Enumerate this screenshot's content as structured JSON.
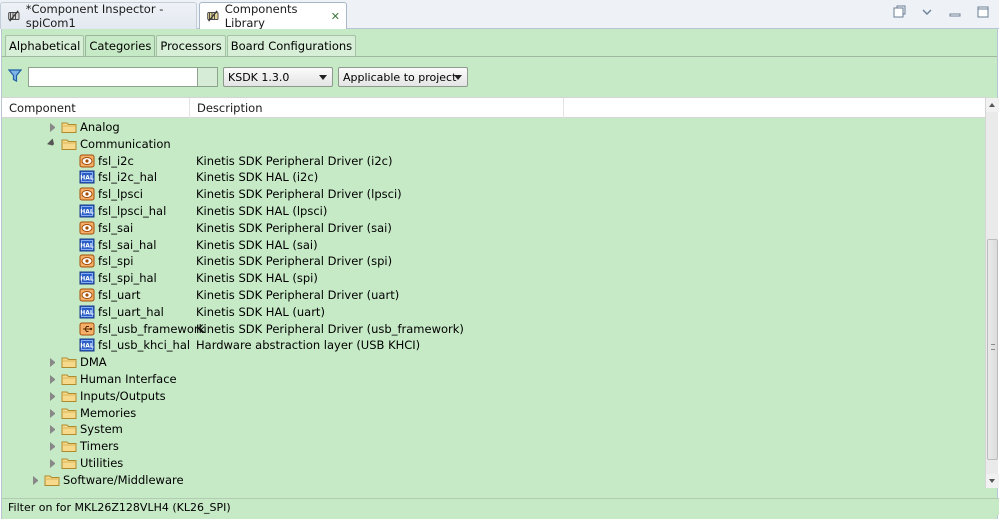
{
  "editor_tabs": [
    {
      "label": "*Component Inspector - spiCom1",
      "active": false
    },
    {
      "label": "Components Library",
      "active": true
    }
  ],
  "view_controls": [
    "restore-icon",
    "view-menu-icon",
    "minimize-icon",
    "maximize-icon"
  ],
  "subtabs": [
    {
      "label": "Alphabetical",
      "active": false
    },
    {
      "label": "Categories",
      "active": true
    },
    {
      "label": "Processors",
      "active": false
    },
    {
      "label": "Board Configurations",
      "active": false
    }
  ],
  "filter": {
    "value": "",
    "placeholder": ""
  },
  "ksdk_select": {
    "value": "KSDK 1.3.0"
  },
  "scope_select": {
    "value": "Applicable to project"
  },
  "columns": {
    "component": "Component",
    "description": "Description"
  },
  "rows": [
    {
      "level": 1,
      "toggle": "collapsed",
      "icon": "folder-icon",
      "name": "Analog",
      "description": ""
    },
    {
      "level": 1,
      "toggle": "expanded",
      "icon": "folder-icon",
      "name": "Communication",
      "description": ""
    },
    {
      "level": 2,
      "toggle": "none",
      "icon": "driver-icon",
      "name": "fsl_i2c",
      "description": "Kinetis SDK Peripheral Driver (i2c)"
    },
    {
      "level": 2,
      "toggle": "none",
      "icon": "hal-icon",
      "name": "fsl_i2c_hal",
      "description": "Kinetis SDK HAL (i2c)"
    },
    {
      "level": 2,
      "toggle": "none",
      "icon": "driver-icon",
      "name": "fsl_lpsci",
      "description": "Kinetis SDK Peripheral Driver (lpsci)"
    },
    {
      "level": 2,
      "toggle": "none",
      "icon": "hal-icon",
      "name": "fsl_lpsci_hal",
      "description": "Kinetis SDK HAL (lpsci)"
    },
    {
      "level": 2,
      "toggle": "none",
      "icon": "driver-icon",
      "name": "fsl_sai",
      "description": "Kinetis SDK Peripheral Driver (sai)"
    },
    {
      "level": 2,
      "toggle": "none",
      "icon": "hal-icon",
      "name": "fsl_sai_hal",
      "description": "Kinetis SDK HAL (sai)"
    },
    {
      "level": 2,
      "toggle": "none",
      "icon": "driver-icon",
      "name": "fsl_spi",
      "description": "Kinetis SDK Peripheral Driver (spi)"
    },
    {
      "level": 2,
      "toggle": "none",
      "icon": "hal-icon",
      "name": "fsl_spi_hal",
      "description": "Kinetis SDK HAL (spi)"
    },
    {
      "level": 2,
      "toggle": "none",
      "icon": "driver-icon",
      "name": "fsl_uart",
      "description": "Kinetis SDK Peripheral Driver (uart)"
    },
    {
      "level": 2,
      "toggle": "none",
      "icon": "hal-icon",
      "name": "fsl_uart_hal",
      "description": "Kinetis SDK HAL (uart)"
    },
    {
      "level": 2,
      "toggle": "none",
      "icon": "usb-driver-icon",
      "name": "fsl_usb_framework",
      "description": "Kinetis SDK Peripheral Driver (usb_framework)"
    },
    {
      "level": 2,
      "toggle": "none",
      "icon": "hal-icon",
      "name": "fsl_usb_khci_hal",
      "description": "Hardware abstraction layer (USB KHCI)"
    },
    {
      "level": 1,
      "toggle": "collapsed",
      "icon": "folder-icon",
      "name": "DMA",
      "description": ""
    },
    {
      "level": 1,
      "toggle": "collapsed",
      "icon": "folder-icon",
      "name": "Human Interface",
      "description": ""
    },
    {
      "level": 1,
      "toggle": "collapsed",
      "icon": "folder-icon",
      "name": "Inputs/Outputs",
      "description": ""
    },
    {
      "level": 1,
      "toggle": "collapsed",
      "icon": "folder-icon",
      "name": "Memories",
      "description": ""
    },
    {
      "level": 1,
      "toggle": "collapsed",
      "icon": "folder-icon",
      "name": "System",
      "description": ""
    },
    {
      "level": 1,
      "toggle": "collapsed",
      "icon": "folder-icon",
      "name": "Timers",
      "description": ""
    },
    {
      "level": 1,
      "toggle": "collapsed",
      "icon": "folder-icon",
      "name": "Utilities",
      "description": ""
    },
    {
      "level": 0,
      "toggle": "collapsed",
      "icon": "folder-icon",
      "name": "Software/Middleware",
      "description": ""
    }
  ],
  "status": "Filter on for MKL26Z128VLH4 (KL26_SPI)",
  "colors": {
    "panel_bg": "#c6e9c6",
    "hal_blue": "#2b5fc8",
    "driver_orange": "#e07a1c",
    "filter_blue": "#2a6fb5"
  }
}
